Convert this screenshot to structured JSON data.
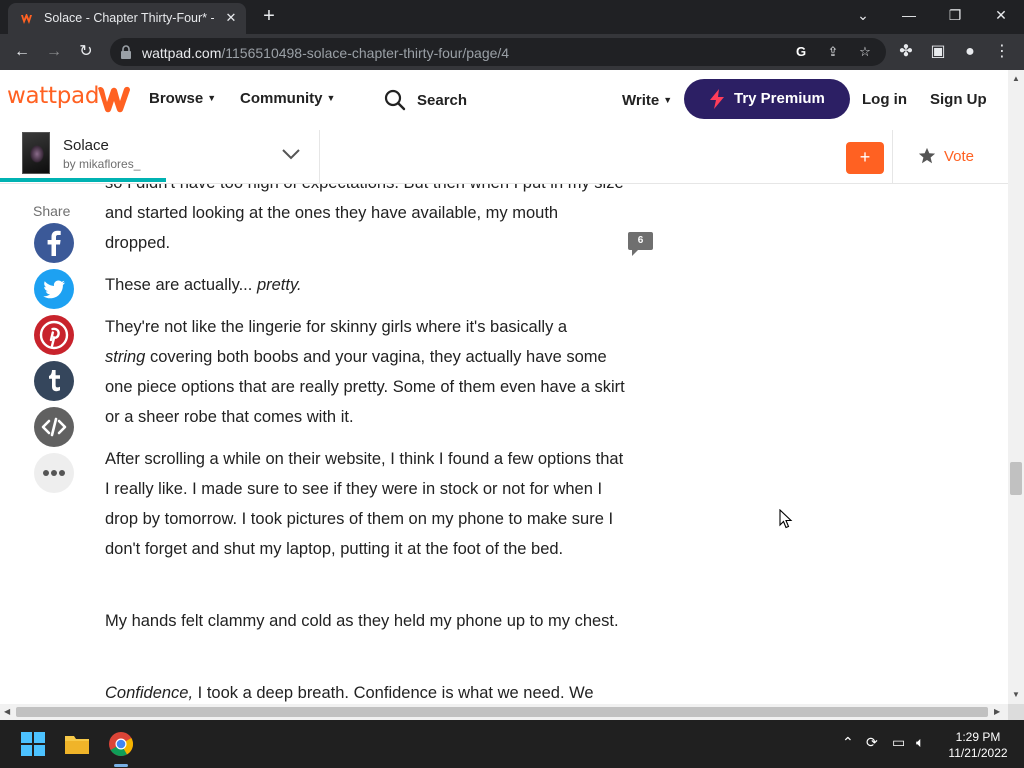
{
  "browser": {
    "tab_title": "Solace - Chapter Thirty-Four* - P",
    "url_host": "wattpad.com",
    "url_path": "/1156510498-solace-chapter-thirty-four/page/4"
  },
  "header": {
    "logo": "wattpad",
    "browse": "Browse",
    "community": "Community",
    "search": "Search",
    "write": "Write",
    "premium": "Try Premium",
    "login": "Log in",
    "signup": "Sign Up"
  },
  "story": {
    "title": "Solace",
    "author": "by mikaflores_",
    "add_label": "+",
    "vote": "Vote",
    "reading_progress": 0.165
  },
  "share": {
    "label": "Share"
  },
  "content": {
    "comment_count": "6",
    "paragraphs": [
      {
        "text": "so I didn't have too high of expectations. But then when I put in my size and started looking at the ones they have available, my mouth dropped."
      },
      {
        "pre": "These are actually... ",
        "em": "pretty."
      },
      {
        "em": "string",
        "pre_line": "They're not like the lingerie for skinny girls where it's basically a",
        "post": " covering both boobs and your vagina, they actually have some one piece options that are really pretty. Some of them even have a skirt or a sheer robe that comes with it."
      },
      {
        "text": "After scrolling a while on their website, I think I found a few options that I really like. I made sure to see if they were in stock or not for when I drop by tomorrow. I took pictures of them on my phone to make sure I don't forget and shut my laptop, putting it at the foot of the bed."
      },
      {
        "text": "My hands felt clammy and cold as they held my phone up to my chest."
      },
      {
        "em": "Confidence,",
        "post": " I took a deep breath. Confidence is what we need. We"
      }
    ]
  },
  "taskbar": {
    "time": "1:29 PM",
    "date": "11/21/2022"
  },
  "colors": {
    "brand_orange": "#ff6122",
    "premium_purple": "#2c1f64",
    "progress_teal": "#00b2b2"
  }
}
